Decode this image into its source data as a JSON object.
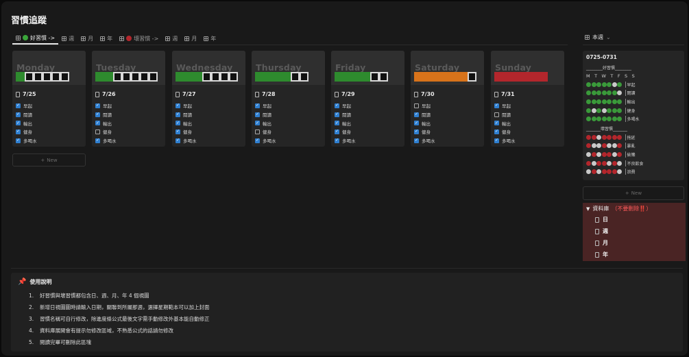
{
  "page_title": "習慣追蹤",
  "tabs": [
    {
      "label": "好習慣 ->",
      "active": true,
      "icon": "grid-icon",
      "dot": "green"
    },
    {
      "label": "週",
      "icon": "grid-icon"
    },
    {
      "label": "月",
      "icon": "calendar-icon"
    },
    {
      "label": "年",
      "icon": "grid-icon"
    },
    {
      "label": "壞習慣 ->",
      "icon": "grid-icon",
      "dot": "red"
    },
    {
      "label": "週",
      "icon": "grid-icon"
    },
    {
      "label": "月",
      "icon": "calendar-icon"
    },
    {
      "label": "年",
      "icon": "grid-icon"
    }
  ],
  "right_tab": {
    "label": "本週",
    "chevron": "⌄"
  },
  "days": [
    {
      "name": "Monday",
      "date": "7/25",
      "progress_color": "#2e8b2e",
      "filled": 1,
      "total": 6,
      "habits": [
        {
          "label": "早起",
          "done": true
        },
        {
          "label": "閱讀",
          "done": true
        },
        {
          "label": "輸出",
          "done": true
        },
        {
          "label": "健身",
          "done": true
        },
        {
          "label": "多喝水",
          "done": true
        }
      ]
    },
    {
      "name": "Tuesday",
      "date": "7/26",
      "progress_color": "#2e8b2e",
      "filled": 2,
      "total": 7,
      "habits": [
        {
          "label": "早起",
          "done": true
        },
        {
          "label": "閱讀",
          "done": true
        },
        {
          "label": "輸出",
          "done": true
        },
        {
          "label": "健身",
          "done": false
        },
        {
          "label": "多喝水",
          "done": true
        }
      ]
    },
    {
      "name": "Wednesday",
      "date": "7/27",
      "progress_color": "#2e8b2e",
      "filled": 3,
      "total": 7,
      "habits": [
        {
          "label": "早起",
          "done": true
        },
        {
          "label": "閱讀",
          "done": true
        },
        {
          "label": "輸出",
          "done": true
        },
        {
          "label": "健身",
          "done": true
        },
        {
          "label": "多喝水",
          "done": true
        }
      ]
    },
    {
      "name": "Thursday",
      "date": "7/28",
      "progress_color": "#2e8b2e",
      "filled": 4,
      "total": 6,
      "habits": [
        {
          "label": "早起",
          "done": true
        },
        {
          "label": "閱讀",
          "done": true
        },
        {
          "label": "輸出",
          "done": true
        },
        {
          "label": "健身",
          "done": false
        },
        {
          "label": "多喝水",
          "done": true
        }
      ]
    },
    {
      "name": "Friday",
      "date": "7/29",
      "progress_color": "#2e8b2e",
      "filled": 4,
      "total": 6,
      "habits": [
        {
          "label": "早起",
          "done": true
        },
        {
          "label": "閱讀",
          "done": true
        },
        {
          "label": "輸出",
          "done": true
        },
        {
          "label": "健身",
          "done": true
        },
        {
          "label": "多喝水",
          "done": true
        }
      ]
    },
    {
      "name": "Saturday",
      "date": "7/30",
      "progress_color": "#d8731a",
      "filled": 6,
      "total": 7,
      "habits": [
        {
          "label": "早起",
          "done": false
        },
        {
          "label": "閱讀",
          "done": true
        },
        {
          "label": "輸出",
          "done": true
        },
        {
          "label": "健身",
          "done": true
        },
        {
          "label": "多喝水",
          "done": true
        }
      ]
    },
    {
      "name": "Sunday",
      "date": "7/31",
      "progress_color": "#b3262c",
      "filled": 6,
      "total": 6,
      "habits": [
        {
          "label": "早起",
          "done": true
        },
        {
          "label": "閱讀",
          "done": false
        },
        {
          "label": "輸出",
          "done": true
        },
        {
          "label": "健身",
          "done": true
        },
        {
          "label": "多喝水",
          "done": true
        }
      ]
    }
  ],
  "new_label": "New",
  "week_summary": {
    "title": "0725-0731",
    "good_header": "________好習慣________",
    "days_header": "M T W T F S S",
    "good_rows": [
      {
        "label": "早起",
        "dots": [
          "g",
          "g",
          "g",
          "g",
          "g",
          "w",
          "g"
        ]
      },
      {
        "label": "閱讀",
        "dots": [
          "g",
          "g",
          "g",
          "g",
          "g",
          "g",
          "w"
        ]
      },
      {
        "label": "輸出",
        "dots": [
          "g",
          "g",
          "g",
          "g",
          "g",
          "g",
          "g"
        ]
      },
      {
        "label": "健身",
        "dots": [
          "g",
          "w",
          "g",
          "w",
          "g",
          "g",
          "g"
        ]
      },
      {
        "label": "多喝水",
        "dots": [
          "g",
          "g",
          "g",
          "g",
          "g",
          "g",
          "g"
        ]
      }
    ],
    "bad_header": "_______壞習慣_______",
    "bad_rows": [
      {
        "label": "拖延",
        "dots": [
          "r",
          "r",
          "w",
          "r",
          "r",
          "r",
          "r"
        ]
      },
      {
        "label": "暴亂",
        "dots": [
          "r",
          "w",
          "w",
          "r",
          "w",
          "w",
          "r"
        ]
      },
      {
        "label": "偷懶",
        "dots": [
          "w",
          "r",
          "w",
          "r",
          "r",
          "w",
          "r"
        ]
      },
      {
        "label": "不良飲食",
        "dots": [
          "r",
          "w",
          "r",
          "r",
          "w",
          "r",
          "w"
        ]
      },
      {
        "label": "浪費",
        "dots": [
          "w",
          "r",
          "w",
          "r",
          "r",
          "r",
          "w"
        ]
      }
    ]
  },
  "database": {
    "title": "資料庫",
    "warning": "（不要刪除‼️）",
    "items": [
      "日",
      "週",
      "月",
      "年"
    ]
  },
  "instructions": {
    "title": "使用說明",
    "items": [
      "好習慣與壞習慣都包含日、週、月、年 4 個視圖",
      "新增日視圖圖時請輸入日期，關聯到所屬那週，選擇星期範本可以加上封面",
      "習慣名稱可自行修改，除進度條公式最後文字需手動修改外基本能自動修正",
      "資料庫展開會有提示勿修改區域，不熟悉公式的話請勿修改",
      "閱讀完畢可刪除此區塊"
    ]
  }
}
